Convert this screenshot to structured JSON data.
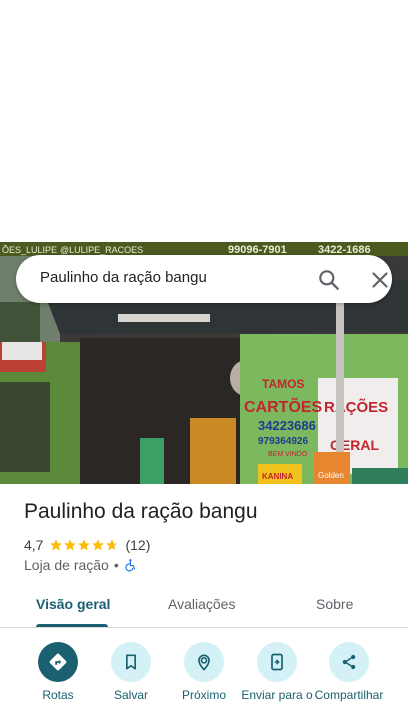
{
  "search": {
    "query": "Paulinho da ração bangu"
  },
  "photo": {
    "banner_left": "ÕES_LULIPE",
    "banner_mid": "@LULIPE_RACOES",
    "banner_phone1": "99096-7901",
    "banner_phone2": "3422-1686",
    "wall_text1": "TAMOS",
    "wall_text2": "CARTÕES",
    "wall_phone1": "34223686",
    "wall_phone2": "979364926",
    "wall_small": "BEM VINDO",
    "racoes_text": "RAÇÕES",
    "geral_text": "GERAL",
    "bag_brand1": "KANINA",
    "bag_brand2": "Golden"
  },
  "place": {
    "title": "Paulinho da ração bangu",
    "rating": "4,7",
    "stars": 4.7,
    "reviews_count": "(12)",
    "category": "Loja de ração",
    "separator": "•"
  },
  "tabs": [
    {
      "label": "Visão geral",
      "active": true
    },
    {
      "label": "Avaliações",
      "active": false
    },
    {
      "label": "Sobre",
      "active": false
    }
  ],
  "actions": [
    {
      "label": "Rotas",
      "icon": "directions-icon"
    },
    {
      "label": "Salvar",
      "icon": "bookmark-icon"
    },
    {
      "label": "Próximo",
      "icon": "nearby-icon"
    },
    {
      "label": "Enviar para o",
      "icon": "send-to-phone-icon"
    },
    {
      "label": "Compartilhar",
      "icon": "share-icon"
    }
  ],
  "colors": {
    "accent": "#1a6070",
    "action_bg": "#d3f1f7",
    "star": "#fbbc04",
    "access": "#1a73e8"
  }
}
